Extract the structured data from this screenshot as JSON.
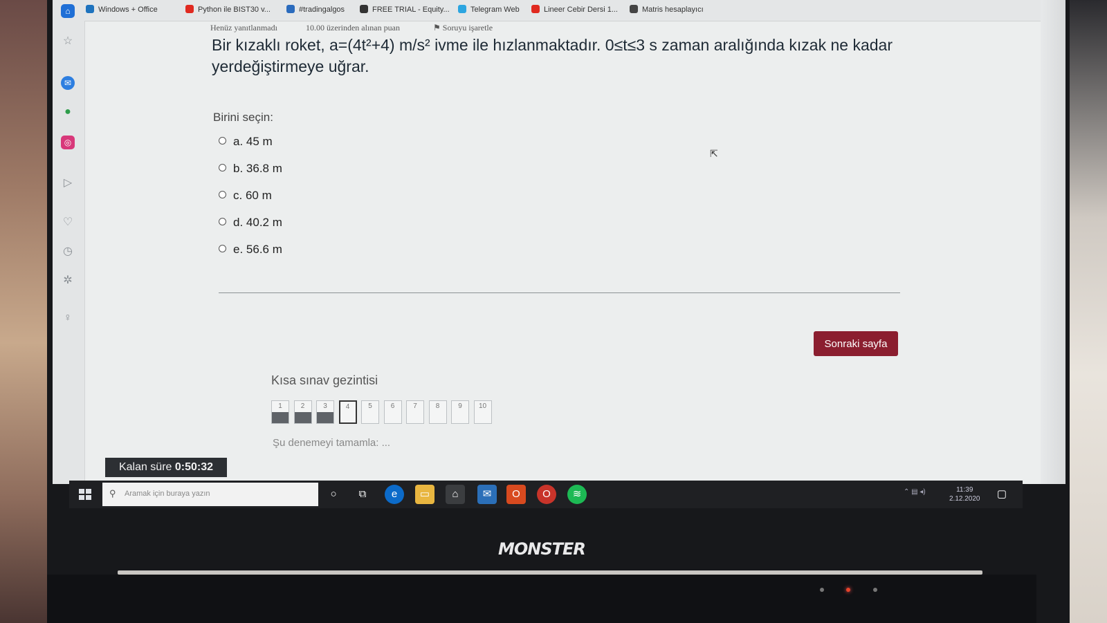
{
  "bookmarks": [
    {
      "label": "Windows + Office",
      "icon": "office-icon",
      "color": "#1e73be"
    },
    {
      "label": "Python ile BIST30 v...",
      "icon": "youtube-icon",
      "color": "#e02a20"
    },
    {
      "label": "#tradingalgos",
      "icon": "tweetdeck-icon",
      "color": "#2a6bbd"
    },
    {
      "label": "FREE TRIAL - Equity...",
      "icon": "diamond-icon",
      "color": "#333333"
    },
    {
      "label": "Telegram Web",
      "icon": "telegram-icon",
      "color": "#2ca5e0"
    },
    {
      "label": "Lineer Cebir Dersi 1...",
      "icon": "youtube-icon",
      "color": "#e02a20"
    },
    {
      "label": "Matris hesaplayıcı",
      "icon": "matrix-icon",
      "color": "#444444"
    }
  ],
  "meta": {
    "status": "Henüz yanıtlanmadı",
    "points": "10.00 üzerinden alınan puan",
    "flag": "Soruyu işaretle"
  },
  "question": {
    "text": "Bir kızaklı roket, a=(4t²+4) m/s² ivme ile hızlanmaktadır. 0≤t≤3 s zaman aralığında kızak ne kadar yerdeğiştirmeye uğrar.",
    "prompt": "Birini seçin:",
    "options": [
      {
        "letter": "a.",
        "value": "45 m"
      },
      {
        "letter": "b.",
        "value": "36.8 m"
      },
      {
        "letter": "c.",
        "value": "60 m"
      },
      {
        "letter": "d.",
        "value": "40.2 m"
      },
      {
        "letter": "e.",
        "value": "56.6 m"
      }
    ]
  },
  "next_button": "Sonraki sayfa",
  "navigation": {
    "title": "Kısa sınav gezintisi",
    "questions": [
      {
        "n": "1",
        "state": "answered"
      },
      {
        "n": "2",
        "state": "answered"
      },
      {
        "n": "3",
        "state": "answered"
      },
      {
        "n": "4",
        "state": "current"
      },
      {
        "n": "5",
        "state": "empty"
      },
      {
        "n": "6",
        "state": "empty"
      },
      {
        "n": "7",
        "state": "empty"
      },
      {
        "n": "8",
        "state": "empty"
      },
      {
        "n": "9",
        "state": "empty"
      },
      {
        "n": "10",
        "state": "empty"
      }
    ],
    "finish": "Şu denemeyi tamamla: ..."
  },
  "timer": {
    "label": "Kalan süre",
    "value": "0:50:32"
  },
  "taskbar": {
    "search_placeholder": "Aramak için buraya yazın",
    "time": "11:39",
    "date": "2.12.2020"
  },
  "laptop_brand": "MONSTER",
  "colors": {
    "accent": "#8b1e2f",
    "answered": "#5f6368"
  }
}
